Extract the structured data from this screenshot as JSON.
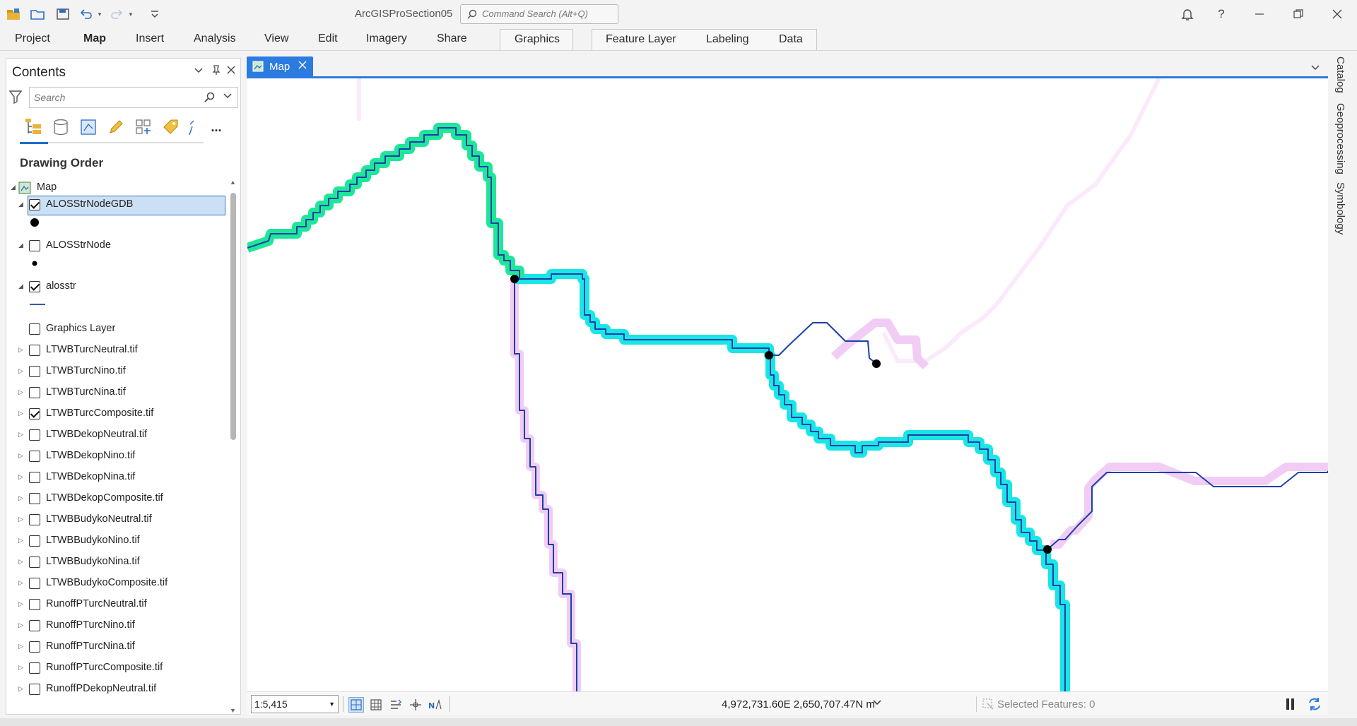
{
  "app": {
    "title": "ArcGISProSection05",
    "command_search_placeholder": "Command Search (Alt+Q)",
    "help": "?"
  },
  "ribbon": {
    "tabs": [
      "Project",
      "Map",
      "Insert",
      "Analysis",
      "View",
      "Edit",
      "Imagery",
      "Share"
    ],
    "active_tab": "Map",
    "contextual_tabs": [
      "Graphics",
      "Feature Layer",
      "Labeling",
      "Data"
    ]
  },
  "contents": {
    "title": "Contents",
    "search_placeholder": "Search",
    "section_title": "Drawing Order",
    "more_label": "...",
    "map_node": "Map",
    "layers": [
      {
        "name": "ALOSStrNodeGDB",
        "checked": true,
        "expandable": true,
        "expanded": true,
        "selected": true,
        "symbol": "large-point"
      },
      {
        "name": "ALOSStrNode",
        "checked": false,
        "expandable": true,
        "expanded": true,
        "selected": false,
        "symbol": "small-point"
      },
      {
        "name": "alosstr",
        "checked": true,
        "expandable": true,
        "expanded": true,
        "selected": false,
        "symbol": "line"
      },
      {
        "name": "Graphics Layer",
        "checked": false,
        "expandable": false
      },
      {
        "name": "LTWBTurcNeutral.tif",
        "checked": false,
        "expandable": true
      },
      {
        "name": "LTWBTurcNino.tif",
        "checked": false,
        "expandable": true
      },
      {
        "name": "LTWBTurcNina.tif",
        "checked": false,
        "expandable": true
      },
      {
        "name": "LTWBTurcComposite.tif",
        "checked": true,
        "expandable": true
      },
      {
        "name": "LTWBDekopNeutral.tif",
        "checked": false,
        "expandable": true
      },
      {
        "name": "LTWBDekopNino.tif",
        "checked": false,
        "expandable": true
      },
      {
        "name": "LTWBDekopNina.tif",
        "checked": false,
        "expandable": true
      },
      {
        "name": "LTWBDekopComposite.tif",
        "checked": false,
        "expandable": true
      },
      {
        "name": "LTWBBudykoNeutral.tif",
        "checked": false,
        "expandable": true
      },
      {
        "name": "LTWBBudykoNino.tif",
        "checked": false,
        "expandable": true
      },
      {
        "name": "LTWBBudykoNina.tif",
        "checked": false,
        "expandable": true
      },
      {
        "name": "LTWBBudykoComposite.tif",
        "checked": false,
        "expandable": true
      },
      {
        "name": "RunoffPTurcNeutral.tif",
        "checked": false,
        "expandable": true
      },
      {
        "name": "RunoffPTurcNino.tif",
        "checked": false,
        "expandable": true
      },
      {
        "name": "RunoffPTurcNina.tif",
        "checked": false,
        "expandable": true
      },
      {
        "name": "RunoffPTurcComposite.tif",
        "checked": false,
        "expandable": true
      },
      {
        "name": "RunoffPDekopNeutral.tif",
        "checked": false,
        "expandable": true
      }
    ]
  },
  "map_view": {
    "tab_label": "Map",
    "scale": "1:5,415",
    "coordinates": "4,972,731.60E 2,650,707.47N m",
    "selected_features": "Selected Features: 0"
  },
  "dock_tabs": [
    "Catalog",
    "Geoprocessing",
    "Symbology"
  ],
  "colors": {
    "accent": "#2c7be0",
    "stream_line": "#1d3fa8",
    "highlight_cyan": "#19e6e6",
    "highlight_green": "#1ee79a",
    "pink_halo": "#f1cdf5",
    "node": "#000000"
  }
}
